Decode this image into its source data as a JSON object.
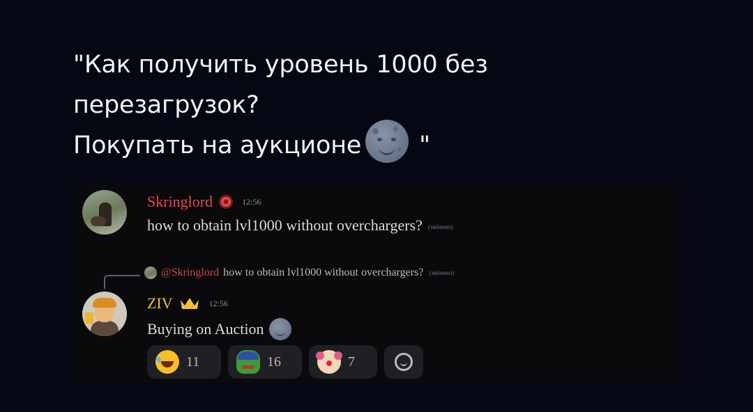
{
  "caption": {
    "line1": "\"Как получить уровень 1000 без",
    "line2": "перезагрузок?",
    "line3": "Покупать на аукционе",
    "line3_end": " \"",
    "emoji": "moon-face-icon"
  },
  "message1": {
    "author": "Skringlord",
    "author_color": "#e8474c",
    "badge_icon": "shield-badge-icon",
    "time": "12:56",
    "text": "how to obtain lvl1000 without overchargers?",
    "edited_label": "(змінено)"
  },
  "reply_preview": {
    "mention": "@Skringlord",
    "text": "how to obtain lvl1000 without overchargers?",
    "edited_label": "(змінено)"
  },
  "message2": {
    "author": "ZIV",
    "author_color": "#f0c233",
    "badge_icon": "crown-icon",
    "time": "12:56",
    "text": "Buying on Auction",
    "emoji": "moon-face-icon"
  },
  "reactions": [
    {
      "emoji": "rofl-emoji",
      "count": "11"
    },
    {
      "emoji": "pepe-emoji",
      "count": "16"
    },
    {
      "emoji": "clown-emoji",
      "count": "7"
    }
  ],
  "add_reaction_icon": "add-reaction-icon"
}
